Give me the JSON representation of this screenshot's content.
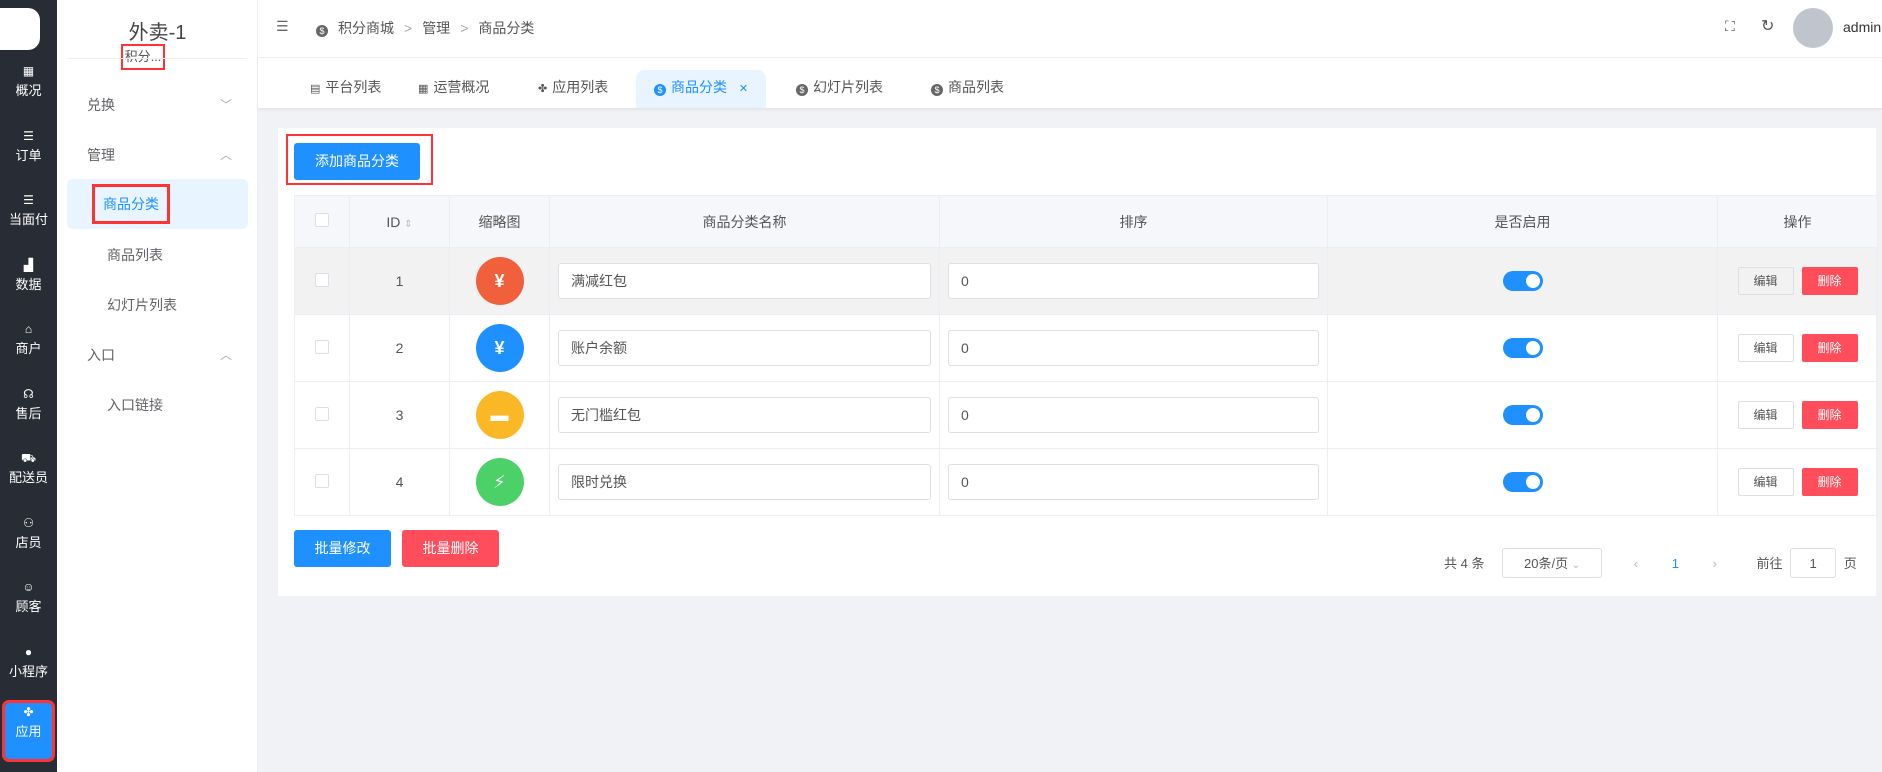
{
  "nav": [
    {
      "icon": "dashboard-icon",
      "label": "概况"
    },
    {
      "icon": "list-icon",
      "label": "订单"
    },
    {
      "icon": "list-icon",
      "label": "当面付"
    },
    {
      "icon": "bar-chart-icon",
      "label": "数据"
    },
    {
      "icon": "store-icon",
      "label": "商户"
    },
    {
      "icon": "headset-icon",
      "label": "售后"
    },
    {
      "icon": "delivery-icon",
      "label": "配送员"
    },
    {
      "icon": "staff-icon",
      "label": "店员"
    },
    {
      "icon": "customer-icon",
      "label": "顾客"
    },
    {
      "icon": "wechat-icon",
      "label": "小程序"
    },
    {
      "icon": "apps-icon",
      "label": "应用"
    }
  ],
  "side": {
    "title": "外卖-1",
    "subtitle": "积分...",
    "menu": [
      {
        "label": "兑换"
      },
      {
        "label": "管理"
      },
      {
        "label": "商品分类"
      },
      {
        "label": "商品列表"
      },
      {
        "label": "幻灯片列表"
      },
      {
        "label": "入口"
      },
      {
        "label": "入口链接"
      }
    ]
  },
  "breadcrumb": [
    "积分商城",
    "管理",
    "商品分类"
  ],
  "user": "admin",
  "tabs": [
    {
      "label": "平台列表"
    },
    {
      "label": "运营概况"
    },
    {
      "label": "应用列表"
    },
    {
      "label": "商品分类"
    },
    {
      "label": "幻灯片列表"
    },
    {
      "label": "商品列表"
    }
  ],
  "add_button": "添加商品分类",
  "table": {
    "headers": [
      "ID",
      "缩略图",
      "商品分类名称",
      "排序",
      "是否启用",
      "操作"
    ],
    "rows": [
      {
        "id": "1",
        "name": "满减红包",
        "sort": "0",
        "enabled": true,
        "color": "#f0603a",
        "glyph": "¥"
      },
      {
        "id": "2",
        "name": "账户余额",
        "sort": "0",
        "enabled": true,
        "color": "#1e90ff",
        "glyph": "¥"
      },
      {
        "id": "3",
        "name": "无门槛红包",
        "sort": "0",
        "enabled": true,
        "color": "#fbb826",
        "glyph": "▬"
      },
      {
        "id": "4",
        "name": "限时兑换",
        "sort": "0",
        "enabled": true,
        "color": "#4cd068",
        "glyph": "⚡"
      }
    ],
    "edit": "编辑",
    "delete": "删除"
  },
  "batch_edit": "批量修改",
  "batch_delete": "批量删除",
  "pagination": {
    "total": "共 4 条",
    "page_size": "20条/页",
    "current": "1",
    "goto_label": "前往",
    "goto_value": "1",
    "page_suffix": "页"
  }
}
